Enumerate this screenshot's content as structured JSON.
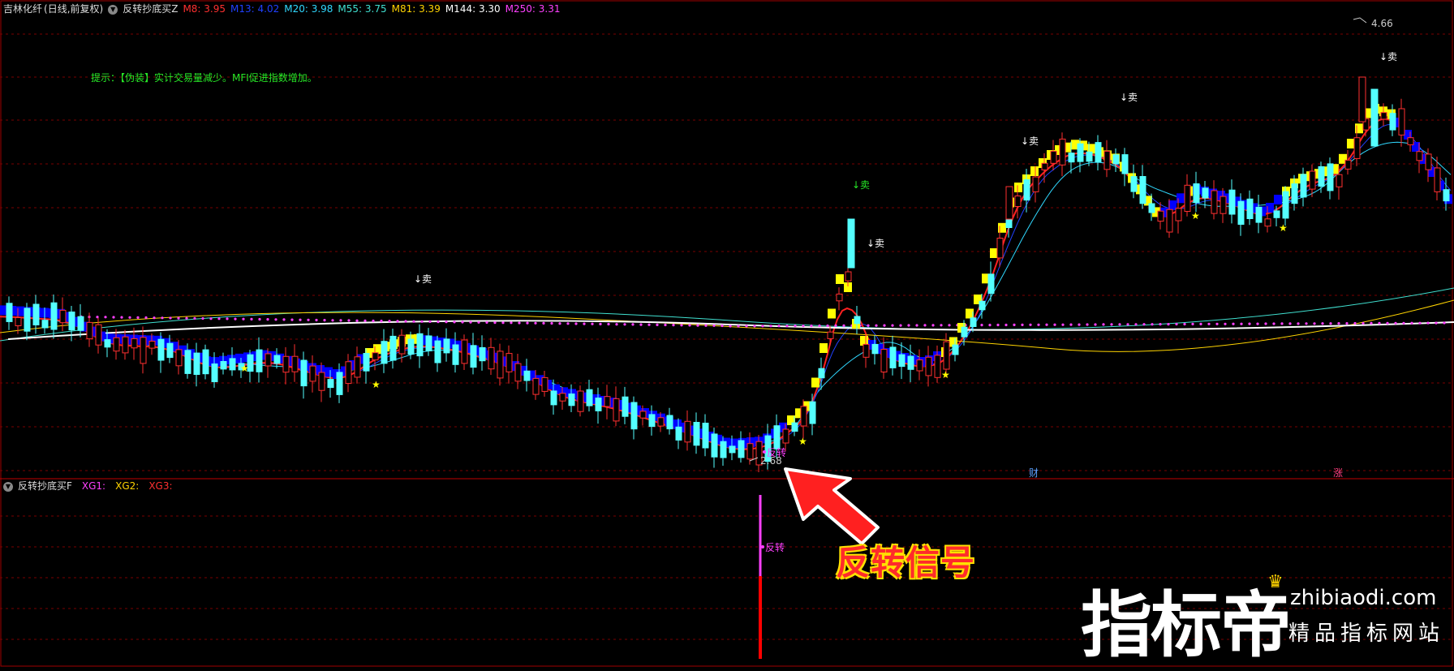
{
  "header": {
    "stock_name": "吉林化纤",
    "period": "(日线,前复权)",
    "indicator_name": "反转抄底买Z",
    "ma": [
      {
        "label": "M8: 3.95",
        "color": "#ff3030"
      },
      {
        "label": "M13: 4.02",
        "color": "#2040ff"
      },
      {
        "label": "M20: 3.98",
        "color": "#30d8ff"
      },
      {
        "label": "M55: 3.75",
        "color": "#40e0d0"
      },
      {
        "label": "M81: 3.39",
        "color": "#ffd400"
      },
      {
        "label": "M144: 3.30",
        "color": "#ffffff"
      },
      {
        "label": "M250: 3.31",
        "color": "#ff40ff"
      }
    ]
  },
  "tip_text": "提示：【伪装】实计交易量减少。MFI促进指数增加。",
  "price_labels": {
    "high": "4.66",
    "low": "2.68"
  },
  "sell_label": "↓卖",
  "reversal_label": "反转",
  "event_labels": {
    "cai": "财",
    "zhang": "涨"
  },
  "sub_header": {
    "indicator_name": "反转抄底买F",
    "items": [
      {
        "label": "XG1:",
        "color": "#ff40ff"
      },
      {
        "label": "XG2:",
        "color": "#ffd400"
      },
      {
        "label": "XG3:",
        "color": "#ff3030"
      }
    ]
  },
  "callout_text": "反转信号",
  "watermark": {
    "cn": "指标帝",
    "en": "zhibiaodi.com",
    "sub": "精品指标网站"
  },
  "colors": {
    "up": "#ff3030",
    "down": "#54ffff",
    "grid": "#7a0000",
    "yellow": "#ffff00",
    "blue": "#0000ff"
  }
}
